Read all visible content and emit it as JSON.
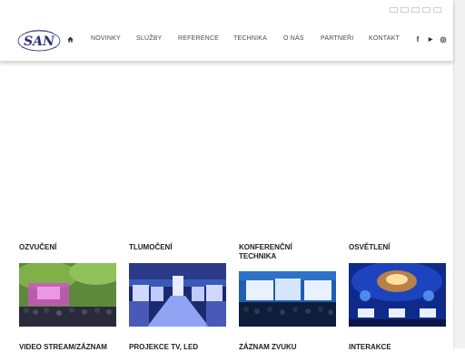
{
  "header": {
    "logo_alt": "SAN",
    "nav": [
      {
        "label": "NOVINKY"
      },
      {
        "label": "SLUŽBY"
      },
      {
        "label": "REFERENCE"
      },
      {
        "label": "TECHNIKA"
      },
      {
        "label": "O NÁS"
      },
      {
        "label": "PARTNEŘI"
      },
      {
        "label": "KONTAKT"
      }
    ],
    "languages": [
      "cz-flag-icon",
      "uk-flag-icon",
      "de-flag-icon",
      "pl-flag-icon",
      "ru-flag-icon"
    ],
    "social": [
      {
        "name": "facebook-icon",
        "glyph": "f"
      },
      {
        "name": "youtube-icon",
        "glyph": "▶"
      },
      {
        "name": "instagram-icon",
        "glyph": "◎"
      }
    ]
  },
  "services": {
    "row1": [
      {
        "title": "OZVUČENÍ"
      },
      {
        "title": "TLUMOČENÍ"
      },
      {
        "title": "KONFERENČNÍ\nTECHNIKA"
      },
      {
        "title": "OSVĚTLENÍ"
      }
    ],
    "row2": [
      {
        "title": "VIDEO STREAM/ZÁZNAM"
      },
      {
        "title": "PROJEKCE TV, LED"
      },
      {
        "title": "ZÁZNAM ZVUKU"
      },
      {
        "title": "INTERAKCE"
      }
    ]
  },
  "colors": {
    "header_bg": "#ffffff",
    "nav_text": "#4a4a4a",
    "title_text": "#1f1f1f",
    "logo_blue": "#2b2f7a"
  }
}
